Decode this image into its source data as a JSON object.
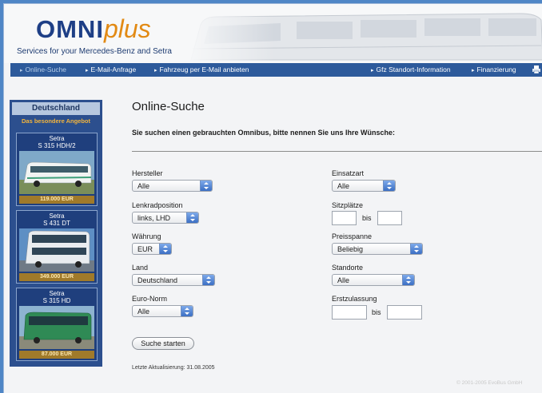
{
  "header": {
    "logo_primary": "OMNI",
    "logo_secondary": "plus",
    "tagline": "Services for your Mercedes-Benz and Setra"
  },
  "nav": {
    "online_search": "Online-Suche",
    "email_request": "E-Mail-Anfrage",
    "offer_vehicle": "Fahrzeug per E-Mail anbieten",
    "locations": "Gfz Standort-Information",
    "financing": "Finanzierung"
  },
  "sidebar": {
    "country": "Deutschland",
    "special_offer": "Das besondere Angebot",
    "cards": [
      {
        "brand": "Setra",
        "model": "S 315 HDH/2",
        "price": "119.000 EUR"
      },
      {
        "brand": "Setra",
        "model": "S 431 DT",
        "price": "349.000 EUR"
      },
      {
        "brand": "Setra",
        "model": "S 315 HD",
        "price": "87.000 EUR"
      }
    ]
  },
  "main": {
    "title": "Online-Suche",
    "intro": "Sie suchen einen gebrauchten Omnibus, bitte nennen Sie uns Ihre Wünsche:",
    "manufacturer": {
      "label": "Hersteller",
      "value": "Alle"
    },
    "steering": {
      "label": "Lenkradposition",
      "value": "links, LHD"
    },
    "currency": {
      "label": "Währung",
      "value": "EUR"
    },
    "country": {
      "label": "Land",
      "value": "Deutschland"
    },
    "euro_norm": {
      "label": "Euro-Norm",
      "value": "Alle"
    },
    "usage": {
      "label": "Einsatzart",
      "value": "Alle"
    },
    "seats": {
      "label": "Sitzplätze",
      "from": "",
      "to": ""
    },
    "price_range": {
      "label": "Preisspanne",
      "value": "Beliebig"
    },
    "locations": {
      "label": "Standorte",
      "value": "Alle"
    },
    "first_registration": {
      "label": "Erstzulassung",
      "from": "",
      "to": ""
    },
    "range_sep": "bis",
    "submit": "Suche starten",
    "last_update": "Letzte Aktualisierung: 31.08.2005"
  },
  "footer": {
    "copyright": "© 2001-2005 EvoBus GmbH"
  }
}
